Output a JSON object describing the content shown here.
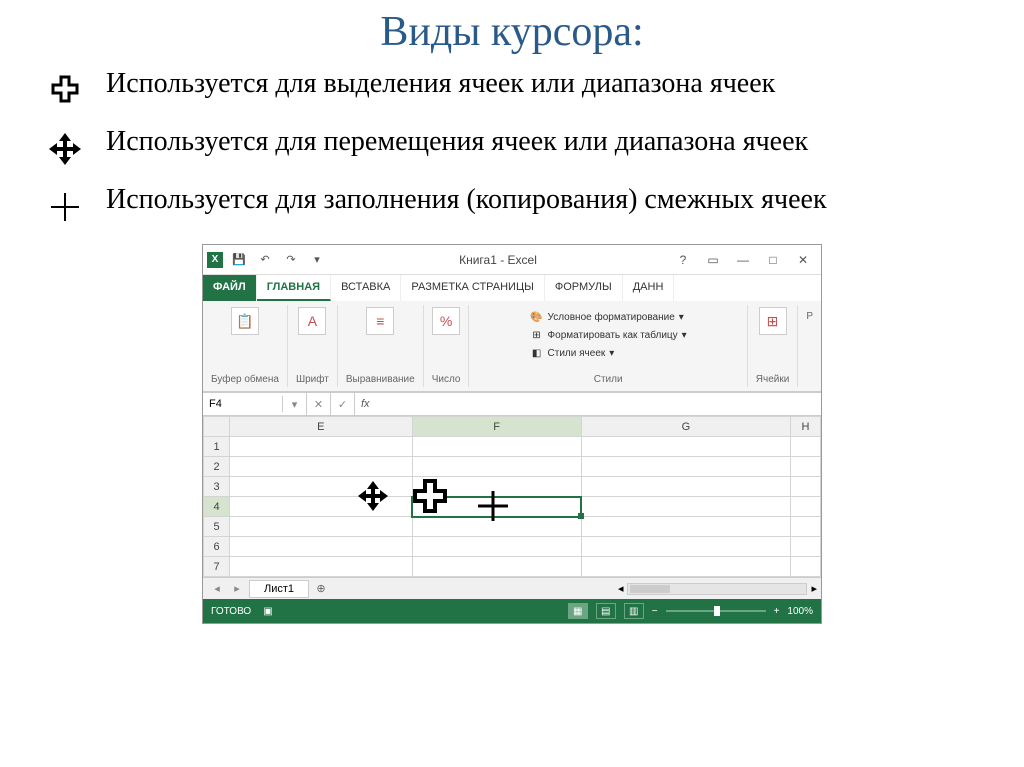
{
  "page_title": "Виды курсора:",
  "items": [
    {
      "text": "Используется для выделения ячеек или диапазона ячеек"
    },
    {
      "text": "Используется для перемещения ячеек или диапазона ячеек"
    },
    {
      "text": "Используется для заполнения (копирования) смежных ячеек"
    }
  ],
  "titlebar": {
    "title": "Книга1 - Excel"
  },
  "tabs": {
    "file": "ФАЙЛ",
    "home": "ГЛАВНАЯ",
    "insert": "ВСТАВКА",
    "layout": "РАЗМЕТКА СТРАНИЦЫ",
    "formulas": "ФОРМУЛЫ",
    "data": "ДАНН"
  },
  "ribbon": {
    "clipboard": "Буфер обмена",
    "font": "Шрифт",
    "alignment": "Выравнивание",
    "number": "Число",
    "styles_label": "Стили",
    "cond_format": "Условное форматирование",
    "format_table": "Форматировать как таблицу",
    "cell_styles": "Стили ячеек",
    "cells": "Ячейки",
    "editing": "Р"
  },
  "namebox": "F4",
  "columns": [
    "E",
    "F",
    "G",
    "H"
  ],
  "rows": [
    "1",
    "2",
    "3",
    "4",
    "5",
    "6",
    "7"
  ],
  "active_col": "F",
  "active_row": "4",
  "sheet": "Лист1",
  "status": {
    "ready": "ГОТОВО",
    "zoom": "100%"
  }
}
